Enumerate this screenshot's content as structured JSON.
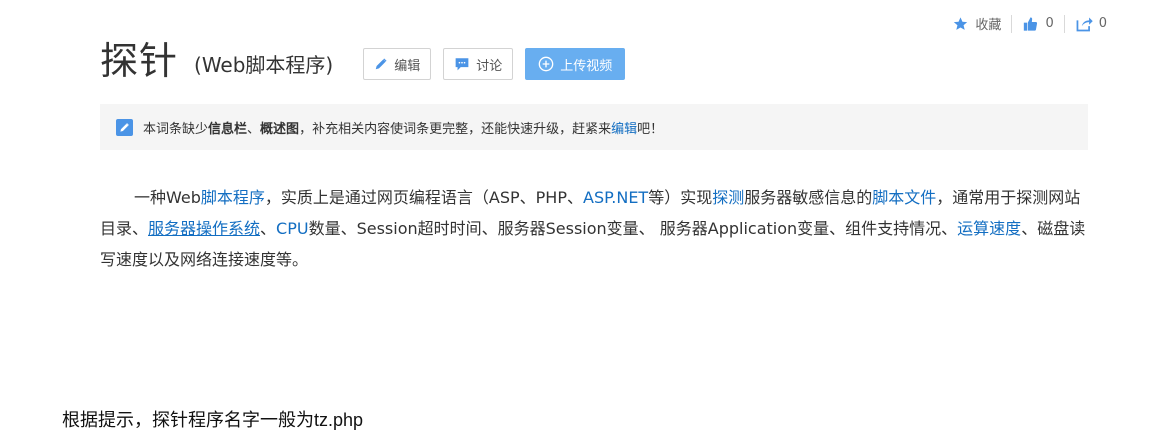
{
  "top_actions": {
    "favorite_label": "收藏",
    "like_count": "0",
    "share_count": "0"
  },
  "header": {
    "title": "探针",
    "subtitle": "(Web脚本程序)",
    "edit_label": "编辑",
    "discuss_label": "讨论",
    "upload_label": "上传视频"
  },
  "notice": {
    "text_1": "本词条缺少",
    "bold_1": "信息栏",
    "sep": "、",
    "bold_2": "概述图",
    "text_2": "，补充相关内容使词条更完整，还能快速升级，赶紧来",
    "link": "编辑",
    "text_3": "吧！"
  },
  "paragraph": {
    "t1": "一种Web",
    "l1": "脚本程序",
    "t2": "，实质上是通过网页编程语言（ASP、PHP、",
    "l2": "ASP.NET",
    "t3": "等）实现",
    "l3": "探测",
    "t4": "服务器敏感信息的",
    "l4": "脚本文件",
    "t5": "，通常用于探测网站目录、",
    "l5": "服务器操作系统",
    "t6": "、",
    "l6": "CPU",
    "t7": "数量、Session超时时间、服务器Session变量、 服务器Application变量、组件支持情况、",
    "l7": "运算速度",
    "t8": "、磁盘读写速度以及网络连接速度等。"
  },
  "footer_note": "根据提示，探针程序名字一般为tz.php",
  "colors": {
    "link": "#136ec2",
    "accent": "#4b94e6",
    "upload_button": "#68aef0",
    "notice_bg": "#f5f5f5"
  },
  "icons": [
    "star-icon",
    "thumbs-up-icon",
    "share-icon",
    "pencil-icon",
    "chat-icon",
    "plus-circle-icon"
  ]
}
